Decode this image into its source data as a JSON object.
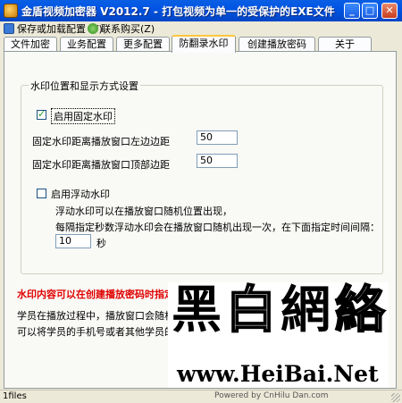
{
  "window": {
    "title": "金盾视频加密器 V2012.7 - 打包视频为单一的受保护的EXE文件",
    "minimize": "_",
    "maximize": "□",
    "close": "✕"
  },
  "menu": {
    "save_load": "保存或加载配置 (Y)",
    "contact": "联系购买(Z)"
  },
  "tabs": [
    {
      "label": "文件加密"
    },
    {
      "label": "业务配置"
    },
    {
      "label": "更多配置"
    },
    {
      "label": "防翻录水印"
    },
    {
      "label": "创建播放密码"
    },
    {
      "label": "关于"
    }
  ],
  "group": {
    "title": "水印位置和显示方式设置",
    "fixed_enable": {
      "label": "启用固定水印",
      "checked": true
    },
    "left_margin": {
      "label": "固定水印距离播放窗口左边边距",
      "value": "50"
    },
    "top_margin": {
      "label": "固定水印距离播放窗口顶部边距",
      "value": "50"
    },
    "float_enable": {
      "label": "启用浮动水印",
      "checked": false
    },
    "float_desc1": "浮动水印可以在播放窗口随机位置出现，",
    "float_desc2": "每隔指定秒数浮动水印会在播放窗口随机出现一次，在下面指定时间间隔：",
    "interval": {
      "value": "10",
      "unit": "秒"
    }
  },
  "red_note": "水印内容可以在创建播放密码时指定，",
  "desc_line1": "学员在播放过程中，播放窗口会随机出现",
  "desc_line2": "可以将学员的手机号或者其他学员的私人",
  "watermark": {
    "chars": [
      "黑",
      "白",
      "網",
      "絡"
    ],
    "url": "www.HeiBai.Net"
  },
  "status": {
    "text": "1files",
    "credit": "Powered by CnHilu Dan.com"
  }
}
